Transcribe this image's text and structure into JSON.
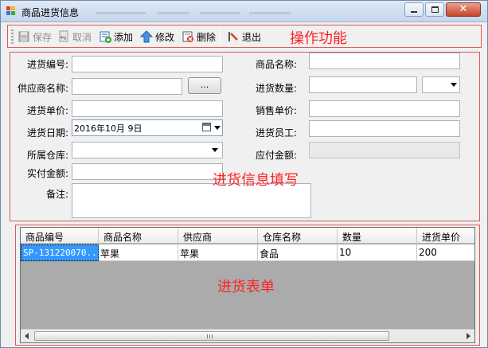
{
  "window": {
    "title": "商品进货信息"
  },
  "toolbar": {
    "save": "保存",
    "cancel": "取消",
    "add": "添加",
    "edit": "修改",
    "delete": "删除",
    "exit": "退出"
  },
  "annotations": {
    "toolbar": "操作功能",
    "form": "进货信息填写",
    "grid": "进货表单"
  },
  "form": {
    "purchase_no_label": "进货编号:",
    "product_name_label": "商品名称:",
    "supplier_label": "供应商名称:",
    "supplier_button": "...",
    "quantity_label": "进货数量:",
    "unit_price_label": "进货单价:",
    "sale_price_label": "销售单价:",
    "date_label": "进货日期:",
    "date_value": "2016年10月  9日",
    "staff_label": "进货员工:",
    "warehouse_label": "所属仓库:",
    "payable_label": "应付金额:",
    "paid_label": "实付金额:",
    "remark_label": "备注:"
  },
  "grid": {
    "columns": [
      "商品编号",
      "商品名称",
      "供应商",
      "仓库名称",
      "数量",
      "进货单价"
    ],
    "rows": [
      [
        "SP-131220070...",
        "苹果",
        "苹果",
        "食品",
        "10",
        "200"
      ]
    ]
  },
  "colors": {
    "accent_red": "#ff2222",
    "selection": "#3399ff"
  }
}
